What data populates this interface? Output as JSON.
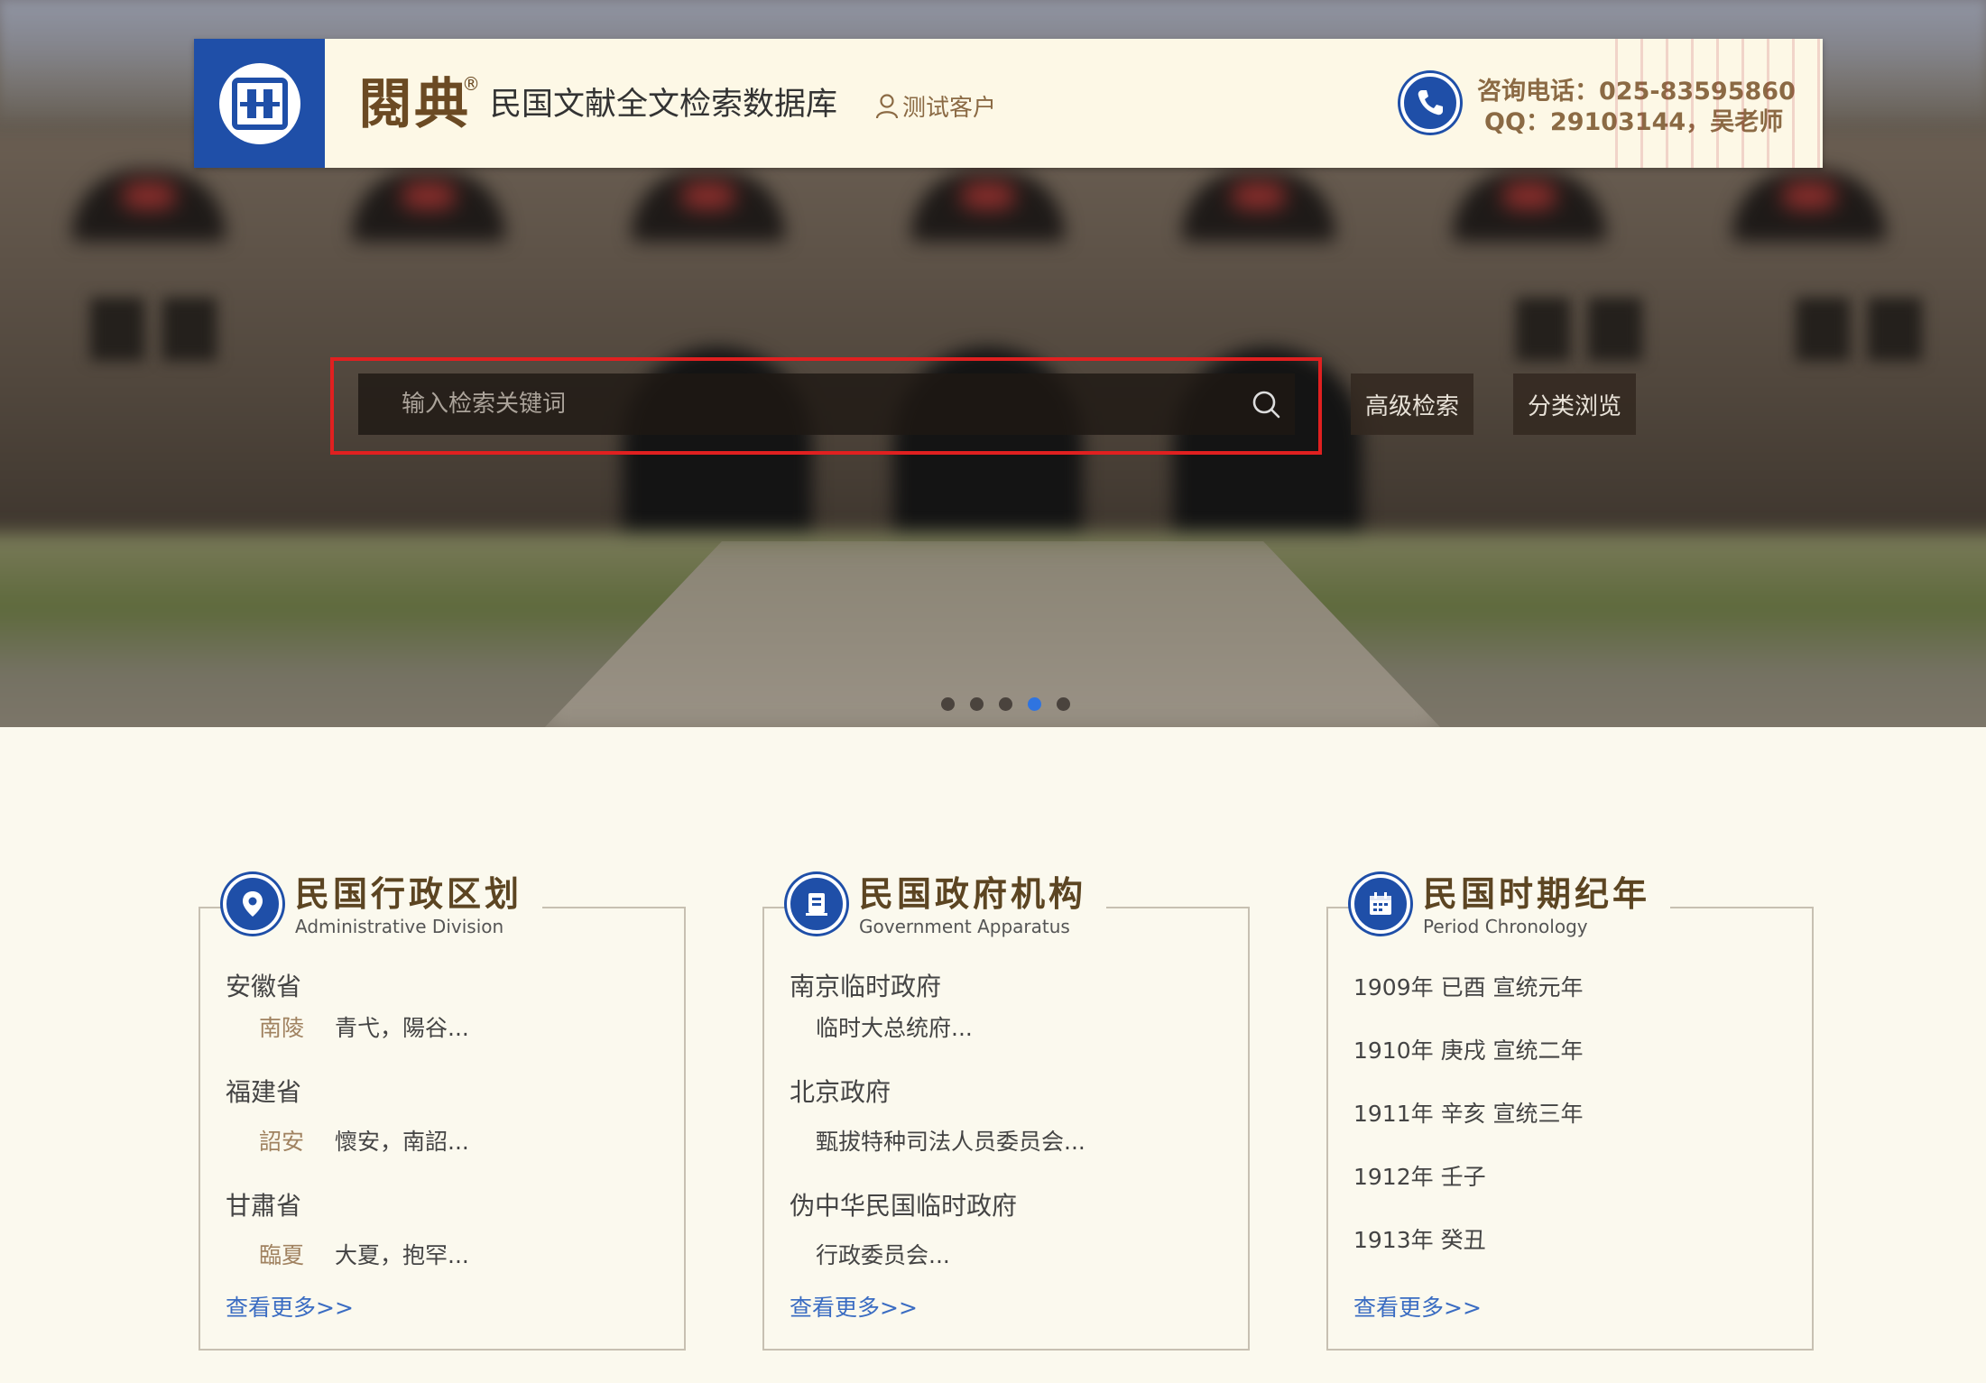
{
  "header": {
    "brand": "閱典",
    "registered_mark": "®",
    "site_name": "民国文献全文检索数据库",
    "user_label": "测试客户",
    "contact_phone": "咨询电话：025-83595860",
    "contact_qq": "QQ：29103144，吴老师"
  },
  "search": {
    "placeholder": "输入检索关键词",
    "advanced_label": "高级检索",
    "browse_label": "分类浏览"
  },
  "carousel": {
    "dot_count": 5,
    "active_index": 3
  },
  "cards": {
    "admin": {
      "title": "民国行政区划",
      "subtitle": "Administrative Division",
      "provinces": [
        {
          "name": "安徽省",
          "key": "南陵",
          "value": "青弋，陽谷..."
        },
        {
          "name": "福建省",
          "key": "詔安",
          "value": "懷安，南詔..."
        },
        {
          "name": "甘肅省",
          "key": "臨夏",
          "value": "大夏，抱罕..."
        }
      ],
      "more": "查看更多>>"
    },
    "gov": {
      "title": "民国政府机构",
      "subtitle": "Government Apparatus",
      "items": [
        {
          "name": "南京临时政府",
          "sub": "临时大总统府..."
        },
        {
          "name": "北京政府",
          "sub": "甄拔特种司法人员委员会..."
        },
        {
          "name": "伪中华民国临时政府",
          "sub": "行政委员会..."
        }
      ],
      "more": "查看更多>>"
    },
    "chrono": {
      "title": "民国时期纪年",
      "subtitle": "Period Chronology",
      "years": [
        "1909年 已酉 宣统元年",
        "1910年 庚戌 宣统二年",
        "1911年 辛亥 宣统三年",
        "1912年 壬子",
        "1913年 癸丑"
      ],
      "more": "查看更多>>"
    }
  },
  "colors": {
    "brand_blue": "#1f4fa8",
    "accent_brown": "#8b6a44",
    "highlight_red": "#e02020",
    "link_blue": "#3a6cc2"
  }
}
